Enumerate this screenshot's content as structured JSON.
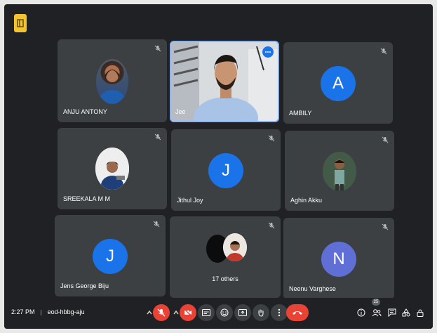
{
  "participants": [
    {
      "name": "ANJU ANTONY",
      "avatar": "photo",
      "muted": true
    },
    {
      "name": "Jee",
      "avatar": "video",
      "muted": false,
      "active": true
    },
    {
      "name": "AMBILY",
      "avatar": "letter",
      "letter": "A",
      "color": "#1a73e8",
      "muted": true
    },
    {
      "name": "SREEKALA M M",
      "avatar": "photo",
      "muted": true
    },
    {
      "name": "Jithul Joy",
      "avatar": "letter",
      "letter": "J",
      "color": "#1a73e8",
      "muted": true
    },
    {
      "name": "Aghin Akku",
      "avatar": "photo",
      "muted": true
    },
    {
      "name": "Jens George Biju",
      "avatar": "letter",
      "letter": "J",
      "color": "#1a73e8",
      "muted": true
    },
    {
      "name": "17 others",
      "avatar": "group",
      "muted": true
    },
    {
      "name": "Neenu Varghese",
      "avatar": "letter",
      "letter": "N",
      "color": "#5f6fd6",
      "muted": true
    }
  ],
  "bottom_bar": {
    "time": "2:27 PM",
    "meeting_code": "eod-hbbg-aju",
    "participants_badge": "25"
  },
  "colors": {
    "background": "#202124",
    "tile": "#3c4043",
    "danger": "#ea4335",
    "accent": "#1a73e8"
  }
}
